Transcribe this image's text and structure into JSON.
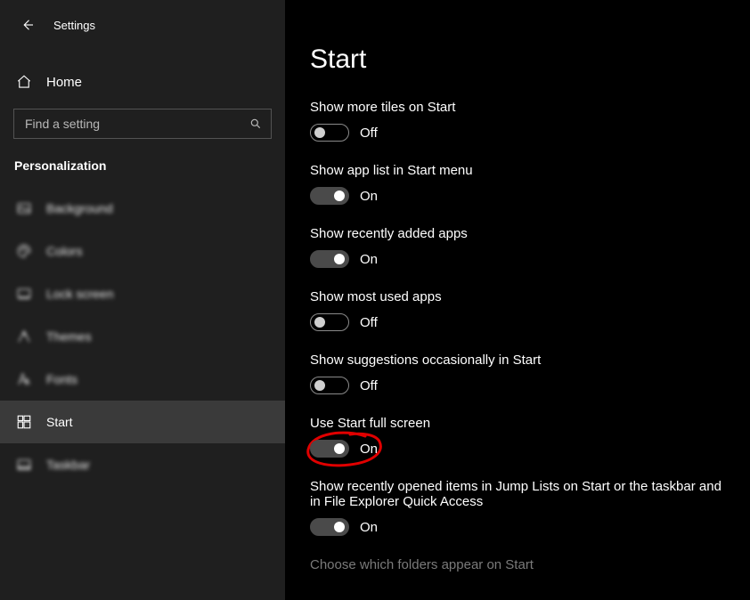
{
  "header": {
    "settings_label": "Settings"
  },
  "sidebar": {
    "home_label": "Home",
    "search_placeholder": "Find a setting",
    "category": "Personalization",
    "items": [
      {
        "label": "Background",
        "icon": "background"
      },
      {
        "label": "Colors",
        "icon": "colors"
      },
      {
        "label": "Lock screen",
        "icon": "lockscreen"
      },
      {
        "label": "Themes",
        "icon": "themes"
      },
      {
        "label": "Fonts",
        "icon": "fonts"
      },
      {
        "label": "Start",
        "icon": "start"
      },
      {
        "label": "Taskbar",
        "icon": "taskbar"
      }
    ]
  },
  "page": {
    "title": "Start",
    "settings": [
      {
        "label": "Show more tiles on Start",
        "state": "Off",
        "on": false
      },
      {
        "label": "Show app list in Start menu",
        "state": "On",
        "on": true
      },
      {
        "label": "Show recently added apps",
        "state": "On",
        "on": true
      },
      {
        "label": "Show most used apps",
        "state": "Off",
        "on": false
      },
      {
        "label": "Show suggestions occasionally in Start",
        "state": "Off",
        "on": false
      },
      {
        "label": "Use Start full screen",
        "state": "On",
        "on": true
      },
      {
        "label": "Show recently opened items in Jump Lists on Start or the taskbar and in File Explorer Quick Access",
        "state": "On",
        "on": true
      }
    ],
    "footer_link": "Choose which folders appear on Start"
  },
  "annotation": {
    "circled_setting_index": 5
  }
}
